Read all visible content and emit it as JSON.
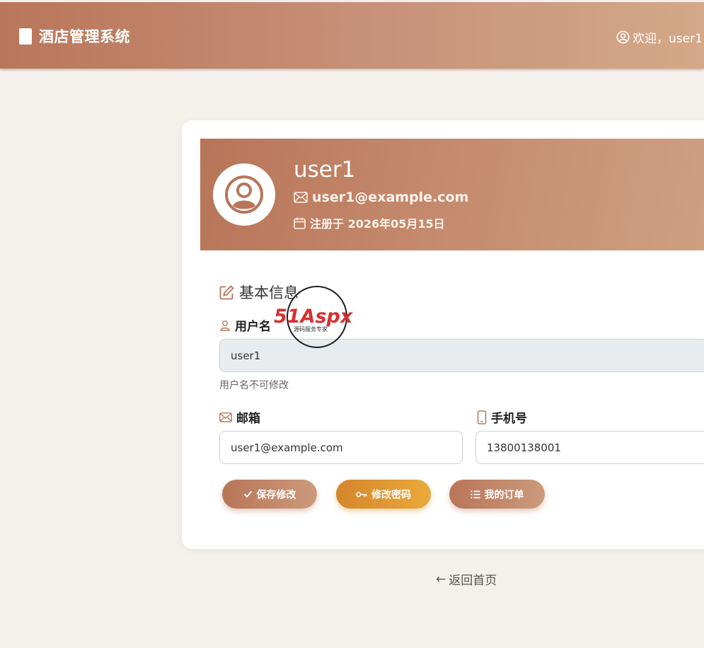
{
  "navbar": {
    "brand": "酒店管理系统",
    "welcome": "欢迎，user1"
  },
  "profile": {
    "username": "user1",
    "email": "user1@example.com",
    "registered": "注册于 2026年05月15日"
  },
  "form": {
    "section_title": "基本信息",
    "username_label": "用户名",
    "username_value": "user1",
    "username_hint": "用户名不可修改",
    "email_label": "邮箱",
    "email_value": "user1@example.com",
    "phone_label": "手机号",
    "phone_value": "13800138001"
  },
  "buttons": {
    "save": "保存修改",
    "change_password": "修改密码",
    "orders": "我的订单"
  },
  "back_link": "返回首页",
  "watermark": {
    "logo": "51Aspx",
    "tagline": "源码服务专家"
  },
  "colors": {
    "primary": "#b87558",
    "accent": "#e39a35",
    "background": "#f4f0ec"
  }
}
